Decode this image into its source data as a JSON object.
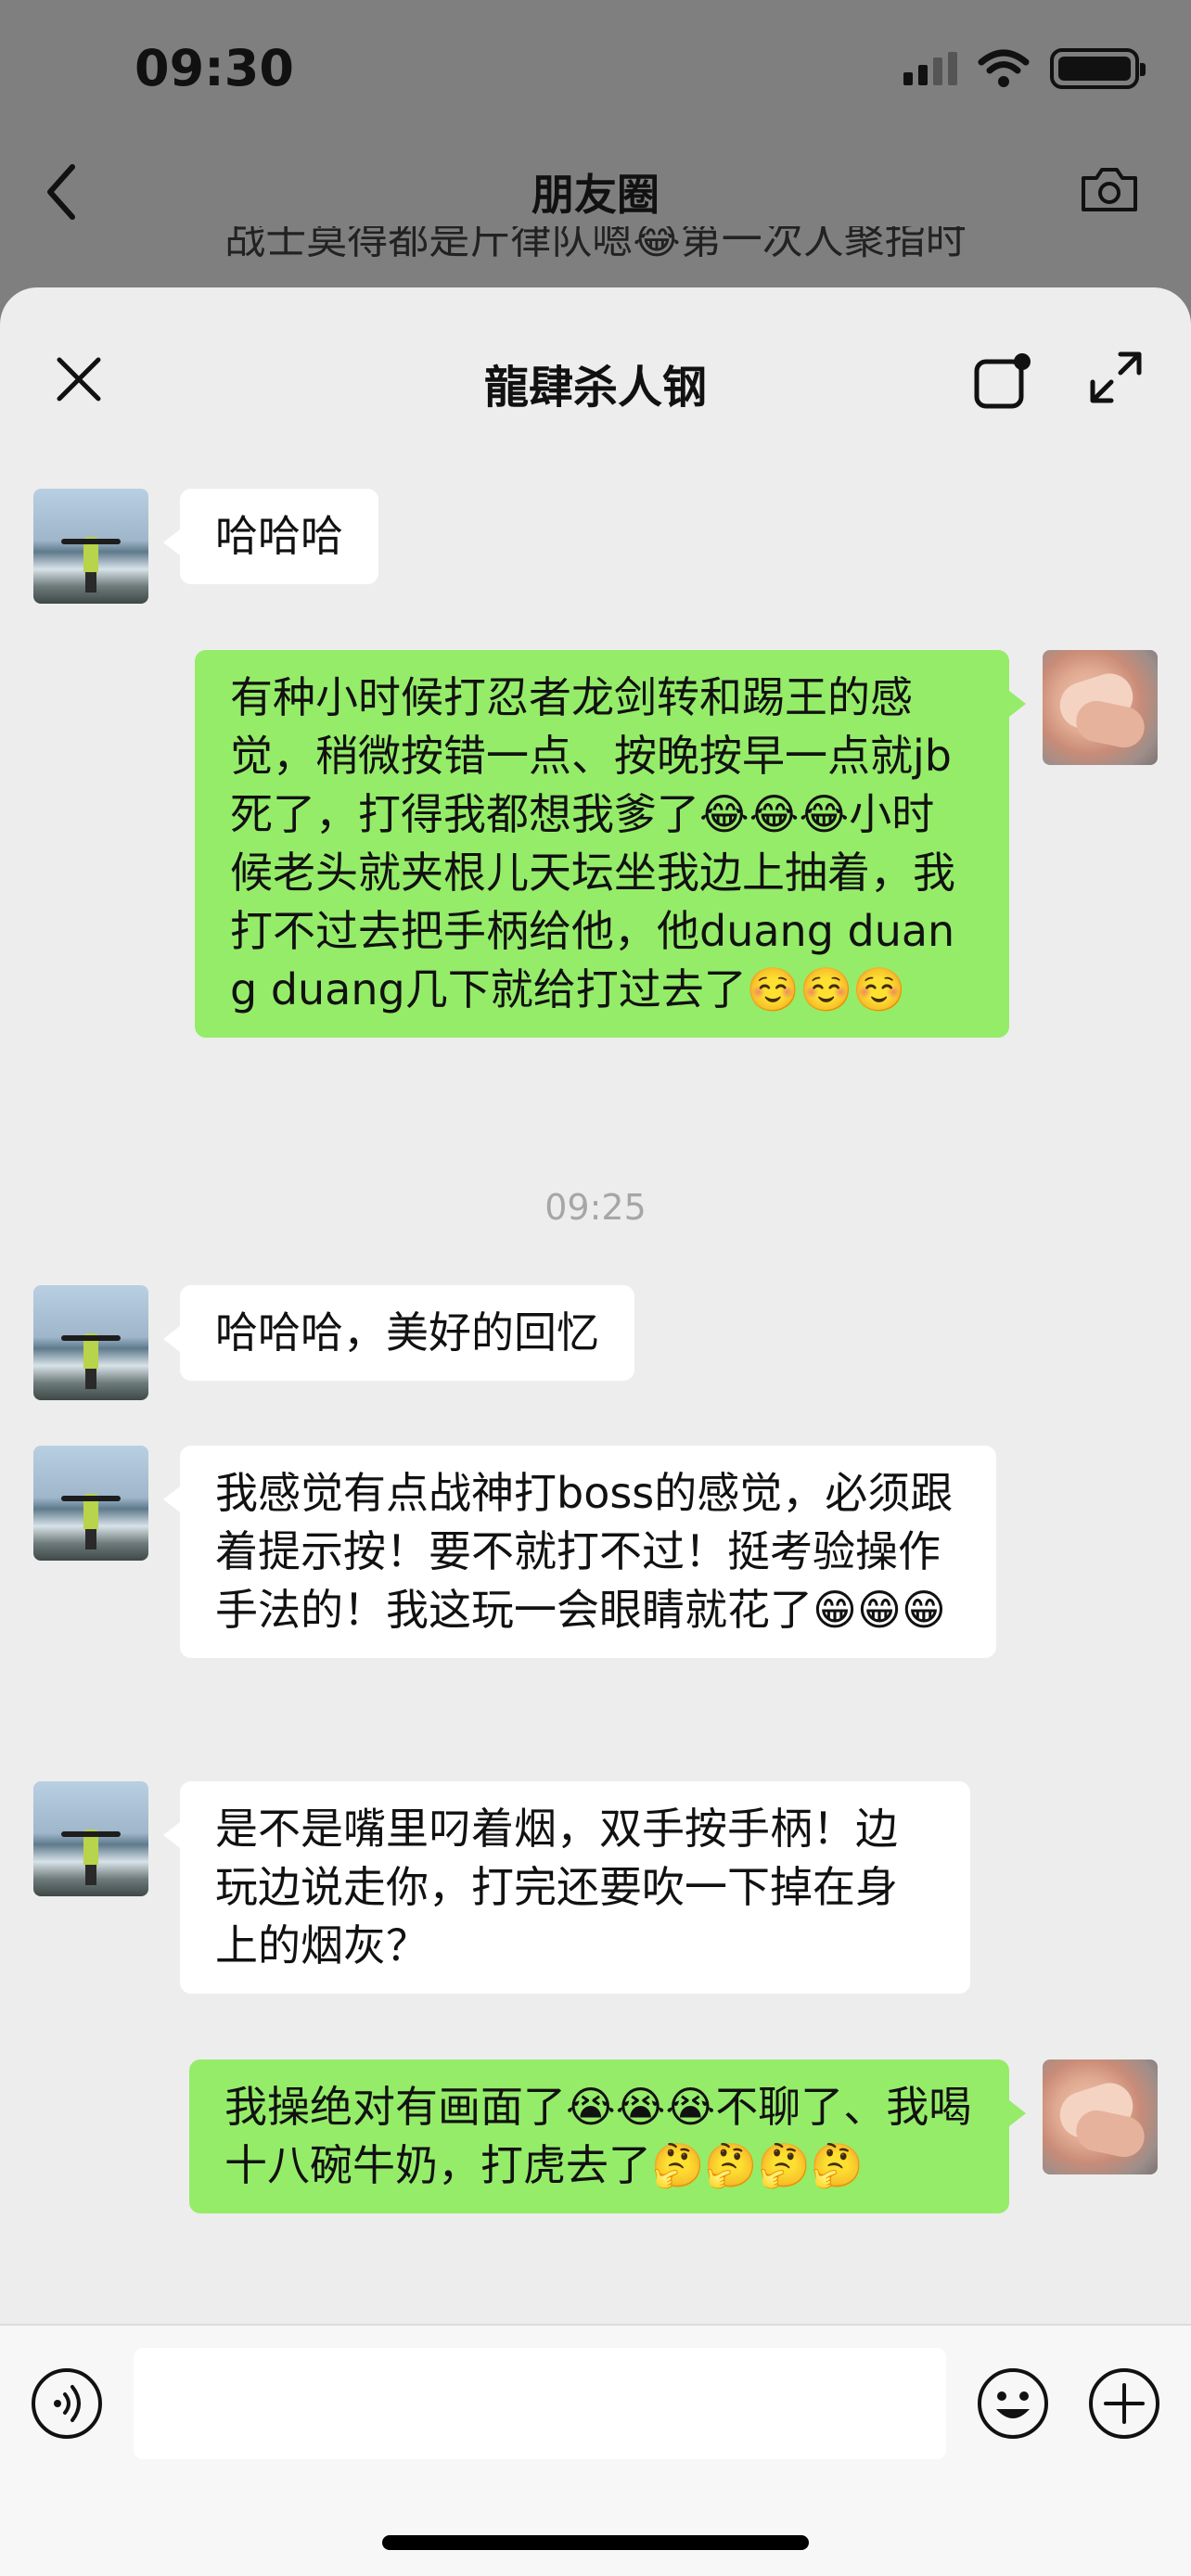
{
  "status_bar": {
    "time": "09:30"
  },
  "background_nav": {
    "title": "朋友圈",
    "peek_text": "战士莫得都是斤律队嗯😂第一次人聚指时"
  },
  "sheet": {
    "title": "龍肆杀人钢"
  },
  "messages": [
    {
      "side": "in",
      "text": "哈哈哈"
    },
    {
      "side": "out",
      "text": "有种小时候打忍者龙剑转和踢王的感觉，稍微按错一点、按晚按早一点就jb死了，打得我都想我爹了😂😂😂小时候老头就夹根儿天坛坐我边上抽着，我打不过去把手柄给他，他duang duang duang几下就给打过去了☺️☺️☺️"
    },
    {
      "side": "in",
      "text": "哈哈哈，美好的回忆"
    },
    {
      "side": "in",
      "text": "我感觉有点战神打boss的感觉，必须跟着提示按！要不就打不过！挺考验操作手法的！我这玩一会眼睛就花了😁😁😁"
    },
    {
      "side": "in",
      "text": "是不是嘴里叼着烟，双手按手柄！边玩边说走你，打完还要吹一下掉在身上的烟灰？"
    },
    {
      "side": "out",
      "text": "我操绝对有画面了😭😭😭不聊了、我喝十八碗牛奶，打虎去了🤔🤔🤔🤔"
    }
  ],
  "timestamp": "09:25",
  "input": {
    "value": ""
  },
  "colors": {
    "out_bubble": "#95ec69",
    "in_bubble": "#ffffff",
    "sheet_bg": "#ededed",
    "dim_bg": "#7f7f7f"
  }
}
